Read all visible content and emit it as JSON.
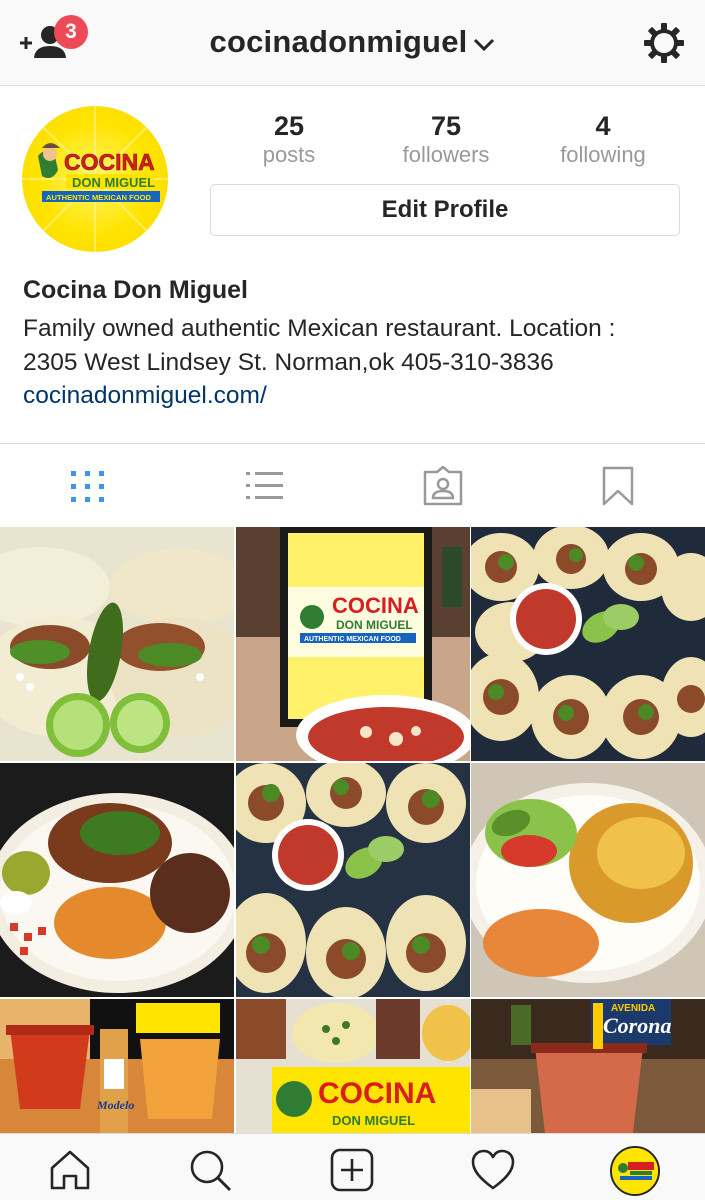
{
  "header": {
    "notification_count": "3",
    "username": "cocinadonmiguel"
  },
  "profile": {
    "logo": {
      "line1": "COCINA",
      "line2": "DON MIGUEL",
      "tagline": "AUTHENTIC MEXICAN FOOD"
    },
    "stats": [
      {
        "value": "25",
        "label": "posts"
      },
      {
        "value": "75",
        "label": "followers"
      },
      {
        "value": "4",
        "label": "following"
      }
    ],
    "edit_label": "Edit Profile",
    "display_name": "Cocina Don Miguel",
    "bio_line1": "Family owned authentic Mexican restaurant. Location :",
    "bio_line2": "2305 West Lindsey St. Norman,ok 405-310-3836",
    "website": "cocinadonmiguel.com/"
  },
  "tabs": [
    "grid-view",
    "list-view",
    "tagged-photos",
    "saved"
  ],
  "grid": {
    "posts": [
      {
        "name": "tacos-with-lime-and-pepper"
      },
      {
        "name": "restaurant-sign-and-menudo"
      },
      {
        "name": "platter-of-tacos-with-salsa"
      },
      {
        "name": "carnitas-plate"
      },
      {
        "name": "tacos-with-salsa-closeup"
      },
      {
        "name": "enchilada-plate"
      },
      {
        "name": "micheladas-and-beer"
      },
      {
        "name": "menu-collage"
      },
      {
        "name": "michelada-cup"
      }
    ],
    "sign_text": "COCINA",
    "sign_sub": "DON MIGUEL",
    "sign_tag": "AUTHENTIC MEXICAN FOOD",
    "collage_text": "COCINA",
    "collage_sub": "DON MIGUEL",
    "beer_brand": "Modelo",
    "corona_text": "Corona",
    "avenida_text": "AVENIDA"
  },
  "colors": {
    "badge": "#ed4956",
    "link": "#003569",
    "active_tab": "#3897f0",
    "logo_yellow": "#ffe400",
    "logo_red": "#d81e1e"
  }
}
